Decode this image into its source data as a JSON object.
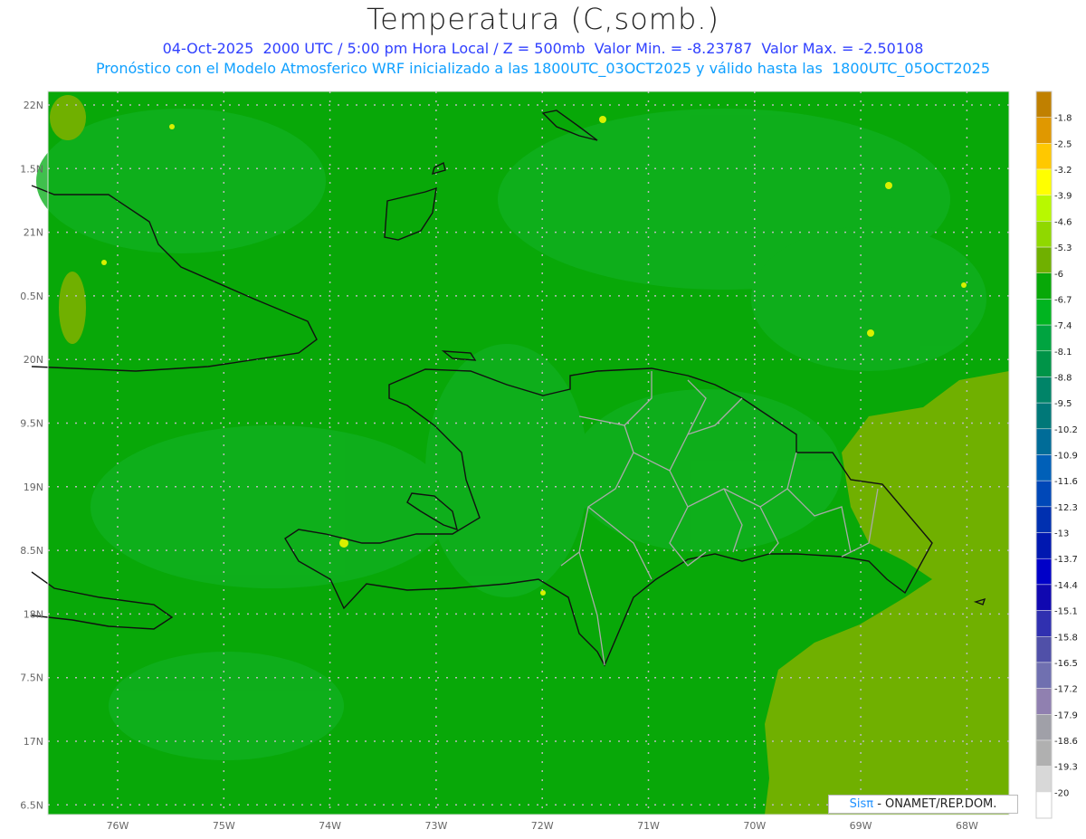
{
  "title": "Temperatura (C,somb.)",
  "subtitle1": "04-Oct-2025  2000 UTC / 5:00 pm Hora Local / Z = 500mb  Valor Min. = -8.23787  Valor Max. = -2.50108",
  "subtitle2": "Pronóstico con el Modelo Atmosferico WRF inicializado a las 1800UTC_03OCT2025 y válido hasta las  1800UTC_05OCT2025",
  "credit": {
    "brand": "Sisπ",
    "text": " - ONAMET/REP.DOM."
  },
  "lat_labels": [
    "22N",
    "1.5N",
    "21N",
    "0.5N",
    "20N",
    "9.5N",
    "19N",
    "8.5N",
    "18N",
    "7.5N",
    "17N",
    "6.5N"
  ],
  "lon_labels": [
    "76W",
    "75W",
    "74W",
    "73W",
    "72W",
    "71W",
    "70W",
    "69W",
    "68W"
  ],
  "colorbar": {
    "labels": [
      "-1.8",
      "-2.5",
      "-3.2",
      "-3.9",
      "-4.6",
      "-5.3",
      "-6",
      "-6.7",
      "-7.4",
      "-8.1",
      "-8.8",
      "-9.5",
      "-10.2",
      "-10.9",
      "-11.6",
      "-12.3",
      "-13",
      "-13.7",
      "-14.4",
      "-15.1",
      "-15.8",
      "-16.5",
      "-17.2",
      "-17.9",
      "-18.6",
      "-19.3",
      "-20"
    ],
    "colors": [
      "#c08000",
      "#e09800",
      "#ffc800",
      "#ffff00",
      "#b8f800",
      "#90d800",
      "#70b000",
      "#08a808",
      "#00b420",
      "#00a440",
      "#009448",
      "#008468",
      "#007878",
      "#006c98",
      "#0060b8",
      "#0048b8",
      "#0030b0",
      "#0018b0",
      "#0000c8",
      "#1008b0",
      "#3030b0",
      "#5050a8",
      "#7070b0",
      "#9080b0",
      "#a0a0a8",
      "#b0b0b0",
      "#d8d8d8",
      "#ffffff"
    ]
  }
}
